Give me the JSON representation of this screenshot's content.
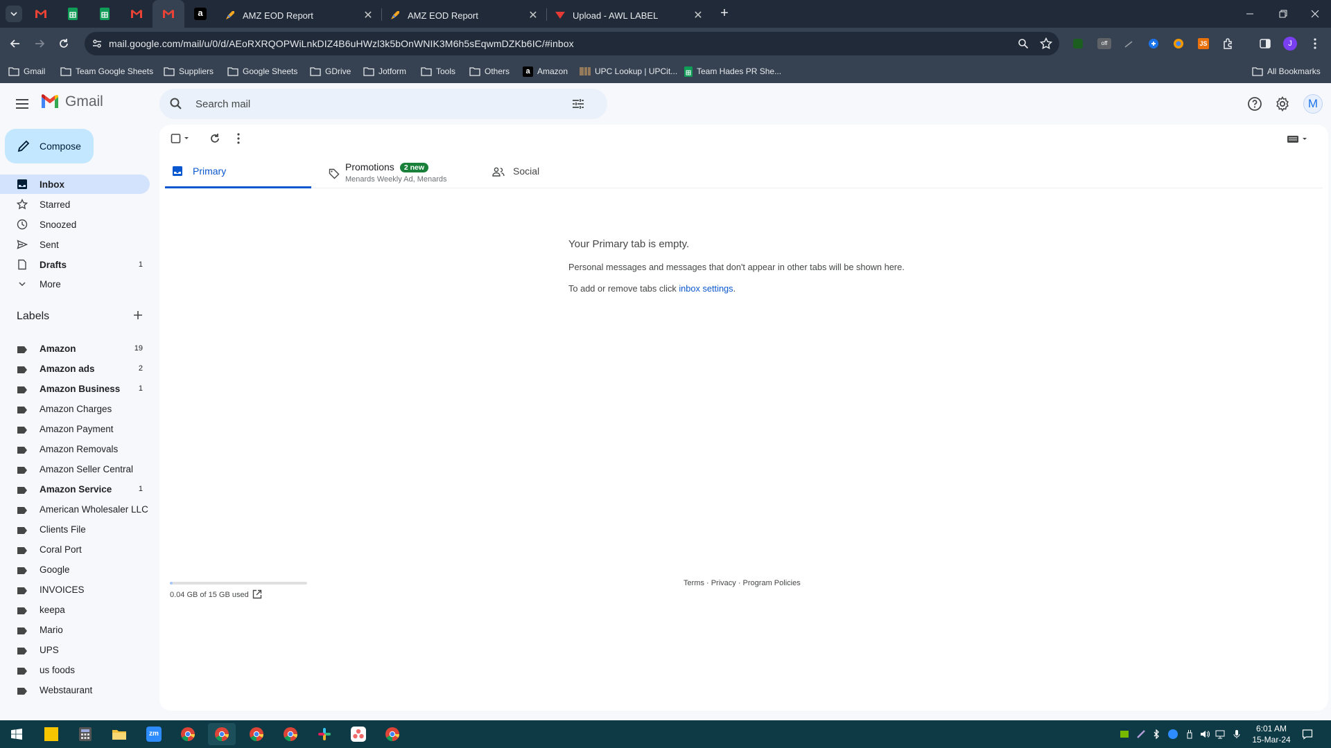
{
  "browser": {
    "tabs": [
      {
        "title": "AMZ EOD Report"
      },
      {
        "title": "AMZ EOD Report"
      },
      {
        "title": "Upload - AWL LABEL"
      }
    ],
    "url": "mail.google.com/mail/u/0/d/AEoRXRQOPWiLnkDIZ4B6uHWzl3k5bOnWNIK3M6h5sEqwmDZKb6IC/#inbox",
    "profile_initial": "J",
    "bookmarks": [
      {
        "label": "Gmail"
      },
      {
        "label": "Team Google Sheets"
      },
      {
        "label": "Suppliers"
      },
      {
        "label": "Google Sheets"
      },
      {
        "label": "GDrive"
      },
      {
        "label": "Jotform"
      },
      {
        "label": "Tools"
      },
      {
        "label": "Others"
      },
      {
        "label": "Amazon"
      },
      {
        "label": "UPC Lookup | UPCit..."
      },
      {
        "label": "Team Hades PR She..."
      }
    ],
    "all_bookmarks": "All Bookmarks"
  },
  "gmail": {
    "logo_text": "Gmail",
    "search_placeholder": "Search mail",
    "avatar_initial": "M",
    "compose_label": "Compose",
    "nav": [
      {
        "label": "Inbox",
        "count": "",
        "icon": "inbox-icon"
      },
      {
        "label": "Starred",
        "count": "",
        "icon": "star-icon"
      },
      {
        "label": "Snoozed",
        "count": "",
        "icon": "clock-icon"
      },
      {
        "label": "Sent",
        "count": "",
        "icon": "send-icon"
      },
      {
        "label": "Drafts",
        "count": "1",
        "icon": "draft-icon"
      },
      {
        "label": "More",
        "count": "",
        "icon": "chevron-down-icon"
      }
    ],
    "labels_heading": "Labels",
    "labels": [
      {
        "label": "Amazon",
        "count": "19",
        "bold": true
      },
      {
        "label": "Amazon ads",
        "count": "2",
        "bold": true
      },
      {
        "label": "Amazon Business",
        "count": "1",
        "bold": true
      },
      {
        "label": "Amazon Charges",
        "count": "",
        "bold": false
      },
      {
        "label": "Amazon Payment",
        "count": "",
        "bold": false
      },
      {
        "label": "Amazon Removals",
        "count": "",
        "bold": false
      },
      {
        "label": "Amazon Seller Central",
        "count": "",
        "bold": false
      },
      {
        "label": "Amazon Service",
        "count": "1",
        "bold": true
      },
      {
        "label": "American Wholesaler LLC",
        "count": "",
        "bold": false
      },
      {
        "label": "Clients File",
        "count": "",
        "bold": false
      },
      {
        "label": "Coral Port",
        "count": "",
        "bold": false
      },
      {
        "label": "Google",
        "count": "",
        "bold": false
      },
      {
        "label": "INVOICES",
        "count": "",
        "bold": false
      },
      {
        "label": "keepa",
        "count": "",
        "bold": false
      },
      {
        "label": "Mario",
        "count": "",
        "bold": false
      },
      {
        "label": "UPS",
        "count": "",
        "bold": false
      },
      {
        "label": "us foods",
        "count": "",
        "bold": false
      },
      {
        "label": "Webstaurant",
        "count": "",
        "bold": false
      }
    ],
    "tabs": {
      "primary": "Primary",
      "promotions": "Promotions",
      "promotions_badge": "2 new",
      "promotions_sub": "Menards Weekly Ad, Menards",
      "social": "Social"
    },
    "empty": {
      "title": "Your Primary tab is empty.",
      "line1": "Personal messages and messages that don't appear in other tabs will be shown here.",
      "line2_prefix": "To add or remove tabs click ",
      "line2_link": "inbox settings",
      "line2_suffix": "."
    },
    "storage": {
      "text": "0.04 GB of 15 GB used",
      "fraction": 0.003
    },
    "footer": "Terms · Privacy · Program Policies"
  },
  "taskbar": {
    "time": "6:01 AM",
    "date": "15-Mar-24"
  },
  "colors": {
    "accent": "#0b57d0",
    "compose_bg": "#c2e7ff",
    "active_nav": "#d3e3fd",
    "taskbar": "#0e3a45"
  }
}
